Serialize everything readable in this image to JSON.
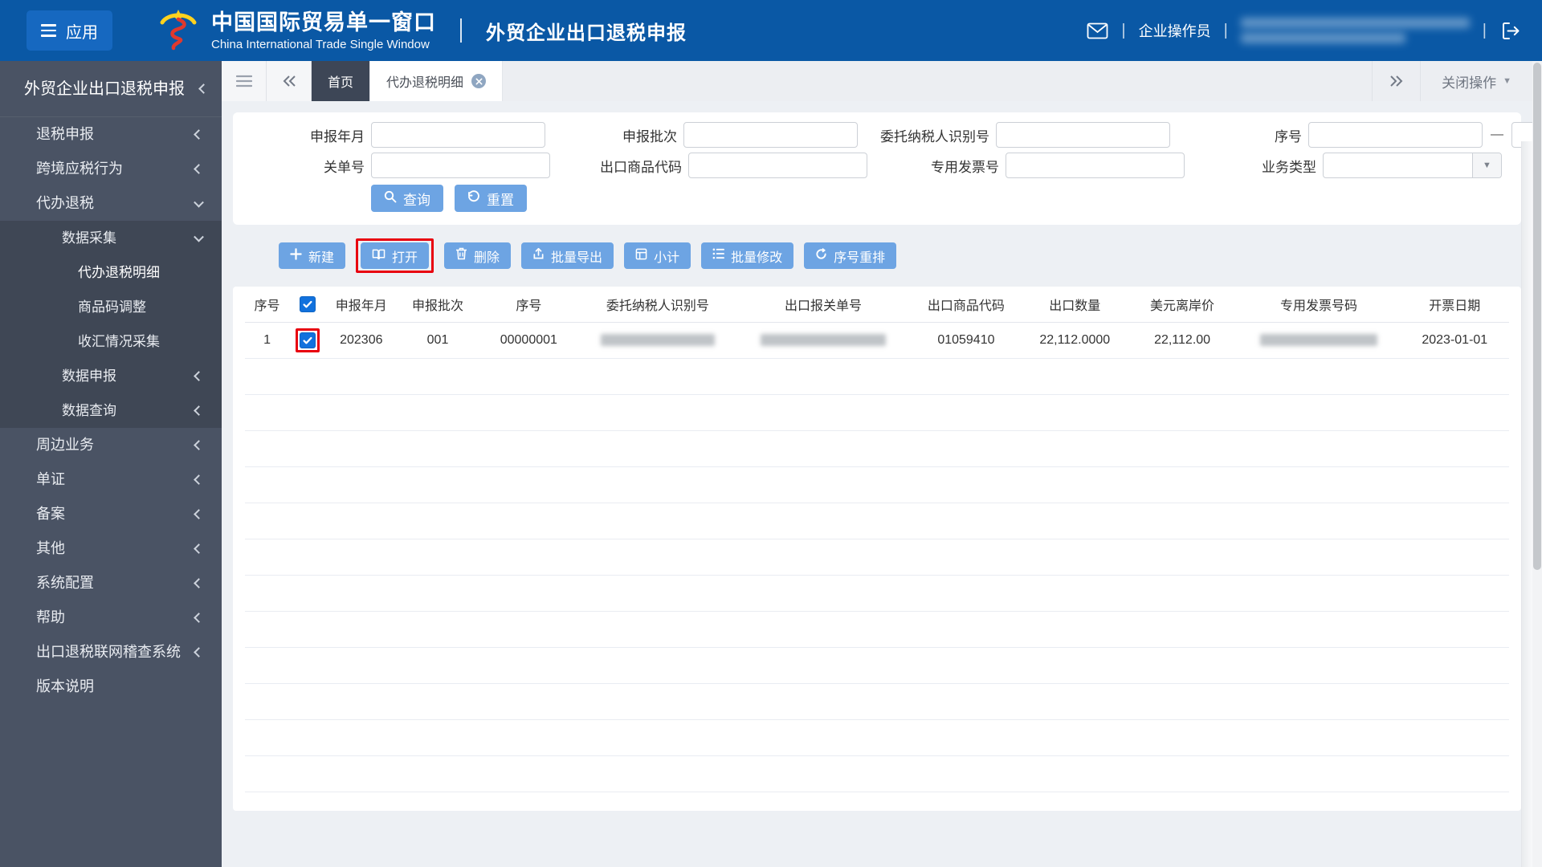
{
  "colors": {
    "header_bg": "#0a58a5",
    "accent_button": "#6da4e3",
    "annotation_red": "#e8000f",
    "checkbox_blue": "#1171dd",
    "active_tab_bg": "#3d4656",
    "sidebar_bg": "#4a5364",
    "sidebar_submenu_bg": "#3f4755"
  },
  "header": {
    "apps_label": "应用",
    "brand_title": "中国国际贸易单一窗口",
    "brand_subtitle": "China International Trade Single Window",
    "app_title": "外贸企业出口退税申报",
    "user_role": "企业操作员"
  },
  "sidebar": {
    "title": "外贸企业出口退税申报",
    "items": [
      {
        "label": "退税申报",
        "level": 1,
        "chevron": "left"
      },
      {
        "label": "跨境应税行为",
        "level": 1,
        "chevron": "left"
      },
      {
        "label": "代办退税",
        "level": 1,
        "chevron": "down",
        "expanded": true
      },
      {
        "label": "数据采集",
        "level": 2,
        "chevron": "down",
        "expanded": true,
        "shaded": true
      },
      {
        "label": "代办退税明细",
        "level": 3,
        "active": true,
        "shaded": true
      },
      {
        "label": "商品码调整",
        "level": 3,
        "shaded": true
      },
      {
        "label": "收汇情况采集",
        "level": 3,
        "shaded": true
      },
      {
        "label": "数据申报",
        "level": 2,
        "chevron": "left",
        "shaded": true
      },
      {
        "label": "数据查询",
        "level": 2,
        "chevron": "left",
        "shaded": true
      },
      {
        "label": "周边业务",
        "level": 1,
        "chevron": "left"
      },
      {
        "label": "单证",
        "level": 1,
        "chevron": "left"
      },
      {
        "label": "备案",
        "level": 1,
        "chevron": "left"
      },
      {
        "label": "其他",
        "level": 1,
        "chevron": "left"
      },
      {
        "label": "系统配置",
        "level": 1,
        "chevron": "left"
      },
      {
        "label": "帮助",
        "level": 1,
        "chevron": "left"
      },
      {
        "label": "出口退税联网稽查系统",
        "level": 1,
        "chevron": "left"
      },
      {
        "label": "版本说明",
        "level": 1
      }
    ]
  },
  "tab_bar": {
    "tabs": [
      {
        "label": "首页",
        "active": true
      },
      {
        "label": "代办退税明细",
        "closable": true
      }
    ],
    "close_menu_label": "关闭操作"
  },
  "search": {
    "rows": [
      [
        {
          "label": "申报年月",
          "type": "input"
        },
        {
          "label": "申报批次",
          "type": "input"
        },
        {
          "label": "委托纳税人识别号",
          "type": "input"
        },
        {
          "label": "序号",
          "type": "range",
          "separator": "—"
        }
      ],
      [
        {
          "label": "关单号",
          "type": "input"
        },
        {
          "label": "出口商品代码",
          "type": "input"
        },
        {
          "label": "专用发票号",
          "type": "input"
        },
        {
          "label": "业务类型",
          "type": "select"
        }
      ]
    ],
    "query_label": "查询",
    "reset_label": "重置"
  },
  "toolbar": {
    "buttons": [
      {
        "name": "new-button",
        "icon": "plus-icon",
        "label": "新建"
      },
      {
        "name": "open-button",
        "icon": "open-icon",
        "label": "打开",
        "annotated": true
      },
      {
        "name": "delete-button",
        "icon": "trash-icon",
        "label": "删除"
      },
      {
        "name": "batch-export-button",
        "icon": "export-icon",
        "label": "批量导出"
      },
      {
        "name": "subtotal-button",
        "icon": "subtotal-icon",
        "label": "小计"
      },
      {
        "name": "batch-modify-button",
        "icon": "list-icon",
        "label": "批量修改"
      },
      {
        "name": "reorder-button",
        "icon": "refresh-icon",
        "label": "序号重排"
      }
    ]
  },
  "table": {
    "columns": [
      {
        "label": "序号"
      },
      {
        "label": "",
        "checkbox": true
      },
      {
        "label": "申报年月"
      },
      {
        "label": "申报批次"
      },
      {
        "label": "序号"
      },
      {
        "label": "委托纳税人识别号"
      },
      {
        "label": "出口报关单号"
      },
      {
        "label": "出口商品代码"
      },
      {
        "label": "出口数量"
      },
      {
        "label": "美元离岸价"
      },
      {
        "label": "专用发票号码"
      },
      {
        "label": "开票日期"
      }
    ],
    "rows": [
      {
        "cells": [
          {
            "text": "1"
          },
          {
            "checkbox": true,
            "checked": true,
            "annotated": true
          },
          {
            "text": "202306"
          },
          {
            "text": "001"
          },
          {
            "text": "00000001"
          },
          {
            "redacted": true
          },
          {
            "redacted": true
          },
          {
            "text": "01059410"
          },
          {
            "text": "22,112.0000"
          },
          {
            "text": "22,112.00"
          },
          {
            "redacted": true
          },
          {
            "text": "2023-01-01"
          }
        ]
      }
    ]
  }
}
